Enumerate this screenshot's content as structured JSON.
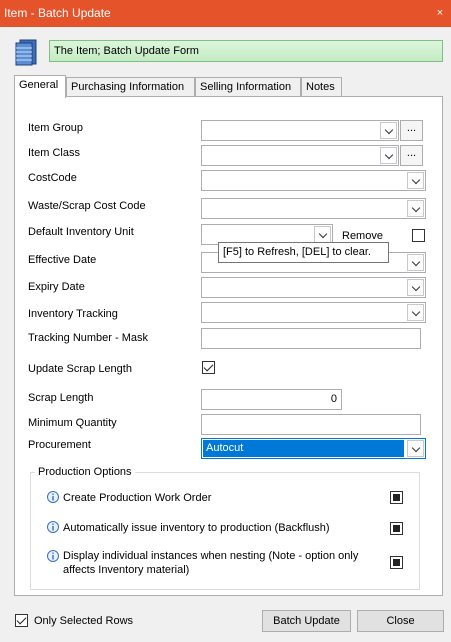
{
  "window": {
    "title": "Item - Batch Update",
    "close_glyph": "×"
  },
  "banner": {
    "text": "The Item; Batch Update Form",
    "icon": "database-stack-icon"
  },
  "tabs": [
    {
      "label": "General",
      "active": true
    },
    {
      "label": "Purchasing Information",
      "active": false
    },
    {
      "label": "Selling Information",
      "active": false
    },
    {
      "label": "Notes",
      "active": false
    }
  ],
  "fields": {
    "item_group": {
      "label": "Item Group",
      "value": "",
      "ellipsis": "..."
    },
    "item_class": {
      "label": "Item Class",
      "value": "",
      "ellipsis": "..."
    },
    "cost_code": {
      "label": "CostCode",
      "value": ""
    },
    "waste_scrap_cost_code": {
      "label": "Waste/Scrap Cost Code",
      "value": ""
    },
    "default_inventory_unit": {
      "label": "Default Inventory Unit",
      "value": "",
      "remove_label": "Remove",
      "remove_checked": false
    },
    "effective_date": {
      "label": "Effective Date",
      "value": ""
    },
    "expiry_date": {
      "label": "Expiry Date",
      "value": ""
    },
    "inventory_tracking": {
      "label": "Inventory Tracking",
      "value": ""
    },
    "tracking_number_mask": {
      "label": "Tracking Number - Mask",
      "value": ""
    },
    "update_scrap_length": {
      "label": "Update Scrap Length",
      "checked": true
    },
    "scrap_length": {
      "label": "Scrap Length",
      "value": "0"
    },
    "minimum_quantity": {
      "label": "Minimum Quantity",
      "value": ""
    },
    "procurement": {
      "label": "Procurement",
      "value": "Autocut"
    }
  },
  "tooltip": {
    "text": "[F5] to Refresh, [DEL] to clear."
  },
  "production_options": {
    "title": "Production Options",
    "options": [
      {
        "text_line1": "Create Production Work Order",
        "text_line2": "",
        "state": "indeterminate"
      },
      {
        "text_line1": "Automatically issue inventory to production (Backflush)",
        "text_line2": "",
        "state": "indeterminate"
      },
      {
        "text_line1": "Display individual instances when nesting (Note - option only",
        "text_line2": "affects Inventory material)",
        "state": "indeterminate"
      }
    ]
  },
  "footer": {
    "only_selected_rows_label": "Only Selected Rows",
    "only_selected_rows_checked": true,
    "batch_update_label": "Batch Update",
    "close_label": "Close"
  },
  "colors": {
    "titlebar": "#e5532b",
    "banner": "#c4ecc4",
    "selection": "#0078d7"
  }
}
